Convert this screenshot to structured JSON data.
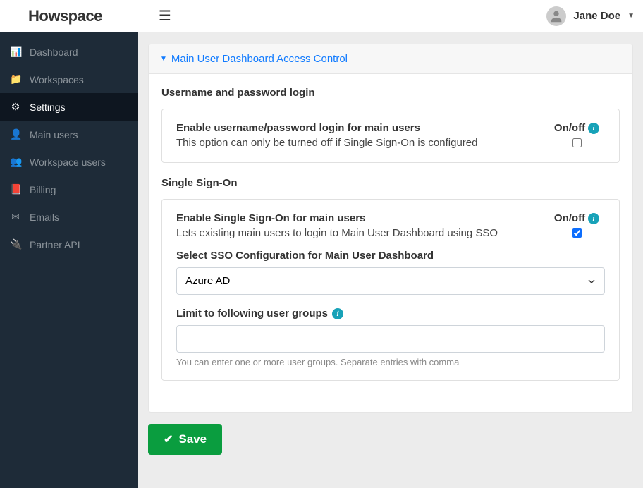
{
  "header": {
    "logo": "Howspace",
    "username": "Jane Doe"
  },
  "sidebar": {
    "items": [
      {
        "label": "Dashboard",
        "icon": "dashboard-icon"
      },
      {
        "label": "Workspaces",
        "icon": "folder-icon"
      },
      {
        "label": "Settings",
        "icon": "gear-icon"
      },
      {
        "label": "Main users",
        "icon": "user-icon"
      },
      {
        "label": "Workspace users",
        "icon": "users-icon"
      },
      {
        "label": "Billing",
        "icon": "book-icon"
      },
      {
        "label": "Emails",
        "icon": "envelope-icon"
      },
      {
        "label": "Partner API",
        "icon": "plug-icon"
      }
    ]
  },
  "panel": {
    "title": "Main User Dashboard Access Control",
    "section_username": {
      "heading": "Username and password login",
      "box_title": "Enable username/password login for main users",
      "box_desc": "This option can only be turned off if Single Sign-On is configured",
      "onoff_label": "On/off",
      "checked": false
    },
    "section_sso": {
      "heading": "Single Sign-On",
      "box_title": "Enable Single Sign-On for main users",
      "box_desc": "Lets existing main users to login to Main User Dashboard using SSO",
      "onoff_label": "On/off",
      "checked": true,
      "select_label": "Select SSO Configuration for Main User Dashboard",
      "select_value": "Azure AD",
      "limit_label": "Limit to following user groups",
      "limit_value": "",
      "limit_hint": "You can enter one or more user groups. Separate entries with comma"
    },
    "save_label": "Save"
  }
}
